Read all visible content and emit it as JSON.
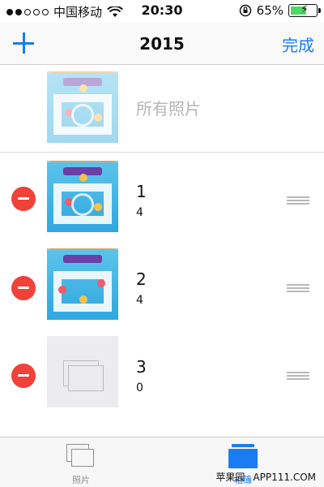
{
  "status_bar": {
    "carrier": "中国移动",
    "time": "20:30",
    "battery_percent": "65%",
    "battery_level": 0.65,
    "battery_color": "#4cd964"
  },
  "nav": {
    "title": "2015",
    "done_label": "完成",
    "accent_color": "#1a7cf2"
  },
  "all_photos": {
    "label": "所有照片"
  },
  "albums": [
    {
      "name": "1",
      "count": "4"
    },
    {
      "name": "2",
      "count": "4"
    },
    {
      "name": "3",
      "count": "0"
    }
  ],
  "tab_bar": {
    "tabs": [
      {
        "label": "照片",
        "icon": "photos-icon",
        "active": false
      },
      {
        "label": "相簿",
        "icon": "albums-icon",
        "active": true
      }
    ]
  },
  "watermark": {
    "brand": "苹果园",
    "site": "APP111.COM"
  }
}
